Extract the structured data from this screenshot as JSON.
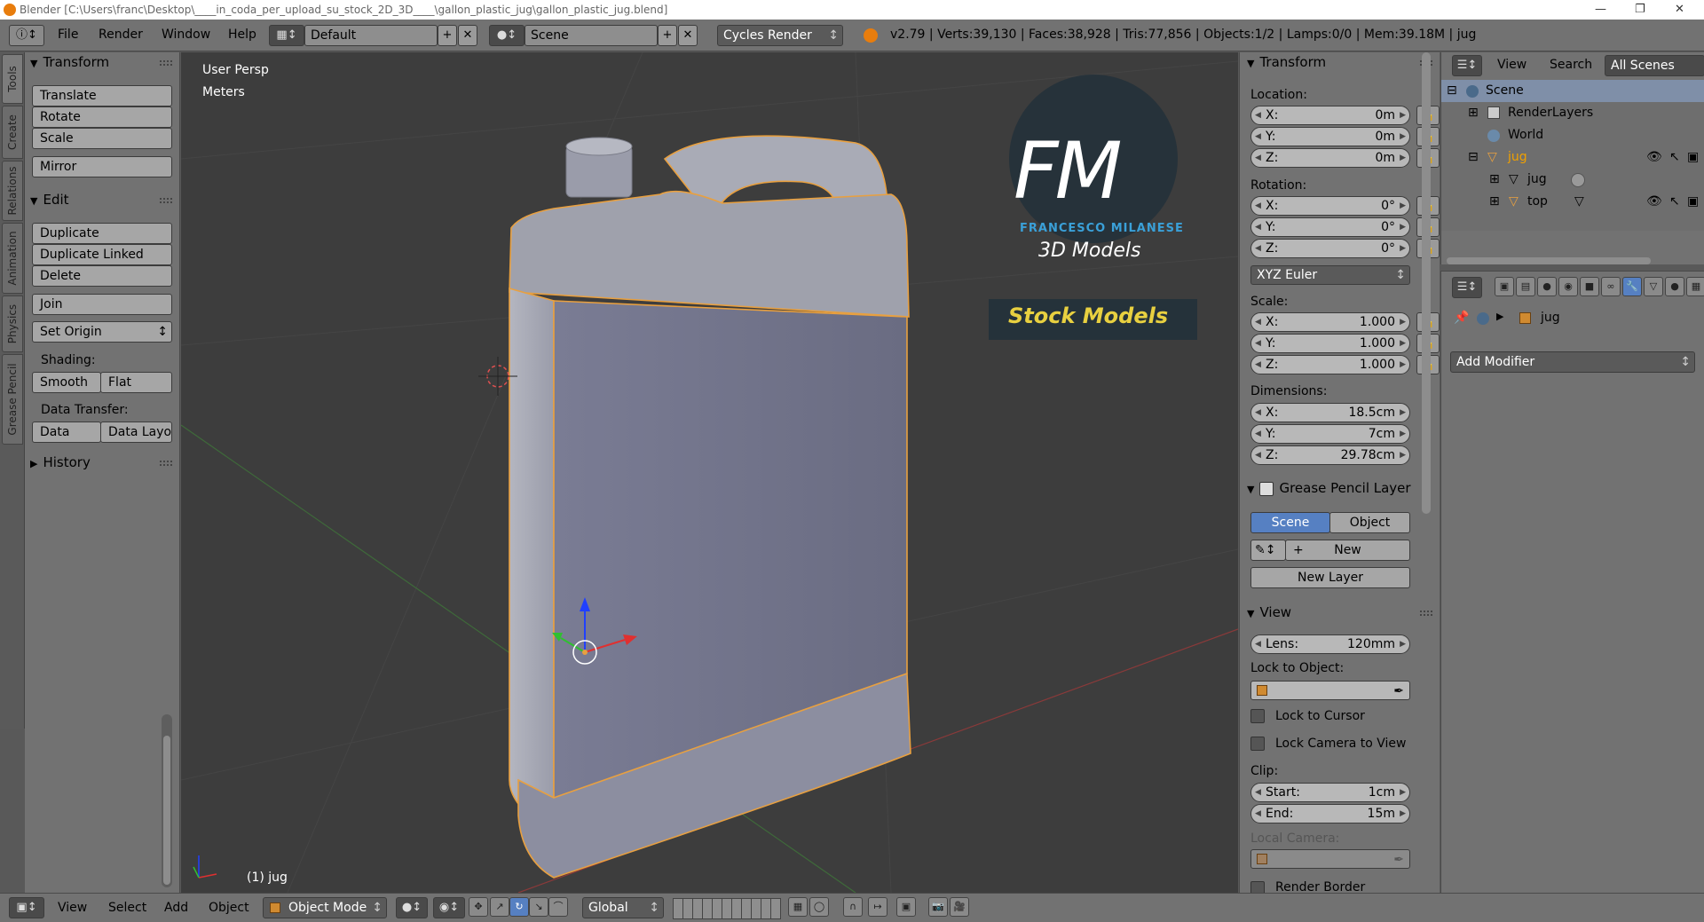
{
  "window": {
    "title": "Blender [C:\\Users\\franc\\Desktop\\____in_coda_per_upload_su_stock_2D_3D____\\gallon_plastic_jug\\gallon_plastic_jug.blend]"
  },
  "topbar": {
    "menus": [
      "File",
      "Render",
      "Window",
      "Help"
    ],
    "layout_name": "Default",
    "scene_name": "Scene",
    "render_engine": "Cycles Render",
    "stats": "v2.79 | Verts:39,130 | Faces:38,928 | Tris:77,856 | Objects:1/2 | Lamps:0/0 | Mem:39.18M | jug"
  },
  "tool_tabs": [
    "Tools",
    "Create",
    "Relations",
    "Animation",
    "Physics",
    "Grease Pencil"
  ],
  "toolshelf": {
    "transform_title": "Transform",
    "transform_buttons": [
      "Translate",
      "Rotate",
      "Scale",
      "Mirror"
    ],
    "edit_title": "Edit",
    "edit_buttons": [
      "Duplicate",
      "Duplicate Linked",
      "Delete",
      "Join"
    ],
    "set_origin": "Set Origin",
    "shading_label": "Shading:",
    "shading_buttons": [
      "Smooth",
      "Flat"
    ],
    "data_transfer_label": "Data Transfer:",
    "data_transfer_buttons": [
      "Data",
      "Data Layo"
    ],
    "history_title": "History"
  },
  "viewport": {
    "view_name": "User Persp",
    "units": "Meters",
    "object_label": "(1) jug",
    "watermark": {
      "line1": "FM",
      "line2": "FRANCESCO MILANESE",
      "line3": "3D Models",
      "banner": "Stock Models"
    }
  },
  "npanel": {
    "transform_title": "Transform",
    "location_label": "Location:",
    "location": [
      {
        "k": "X:",
        "v": "0m"
      },
      {
        "k": "Y:",
        "v": "0m"
      },
      {
        "k": "Z:",
        "v": "0m"
      }
    ],
    "rotation_label": "Rotation:",
    "rotation": [
      {
        "k": "X:",
        "v": "0°"
      },
      {
        "k": "Y:",
        "v": "0°"
      },
      {
        "k": "Z:",
        "v": "0°"
      }
    ],
    "rotation_mode": "XYZ Euler",
    "scale_label": "Scale:",
    "scale": [
      {
        "k": "X:",
        "v": "1.000"
      },
      {
        "k": "Y:",
        "v": "1.000"
      },
      {
        "k": "Z:",
        "v": "1.000"
      }
    ],
    "dimensions_label": "Dimensions:",
    "dimensions": [
      {
        "k": "X:",
        "v": "18.5cm"
      },
      {
        "k": "Y:",
        "v": "7cm"
      },
      {
        "k": "Z:",
        "v": "29.78cm"
      }
    ],
    "grease_pencil_title": "Grease Pencil Layer",
    "gp_tabs": [
      "Scene",
      "Object"
    ],
    "gp_new": "New",
    "gp_new_layer": "New Layer",
    "view_title": "View",
    "lens_label": "Lens:",
    "lens_value": "120mm",
    "lock_to_object_label": "Lock to Object:",
    "lock_to_cursor": "Lock to Cursor",
    "lock_camera": "Lock Camera to View",
    "clip_label": "Clip:",
    "clip_start_label": "Start:",
    "clip_start": "1cm",
    "clip_end_label": "End:",
    "clip_end": "15m",
    "local_camera_label": "Local Camera:",
    "render_border": "Render Border"
  },
  "outliner": {
    "menus": [
      "View",
      "Search"
    ],
    "filter": "All Scenes",
    "rows": [
      "Scene",
      "RenderLayers",
      "World",
      "jug",
      "jug",
      "top"
    ]
  },
  "properties": {
    "object_name": "jug",
    "add_modifier": "Add Modifier"
  },
  "bottombar": {
    "menus": [
      "View",
      "Select",
      "Add",
      "Object"
    ],
    "mode": "Object Mode",
    "orientation": "Global"
  },
  "colors": {
    "selection_outline": "#e8a040",
    "active_tab": "#5680c2",
    "logo_blue": "#3aa0d8",
    "stock_yellow": "#e8d040"
  }
}
